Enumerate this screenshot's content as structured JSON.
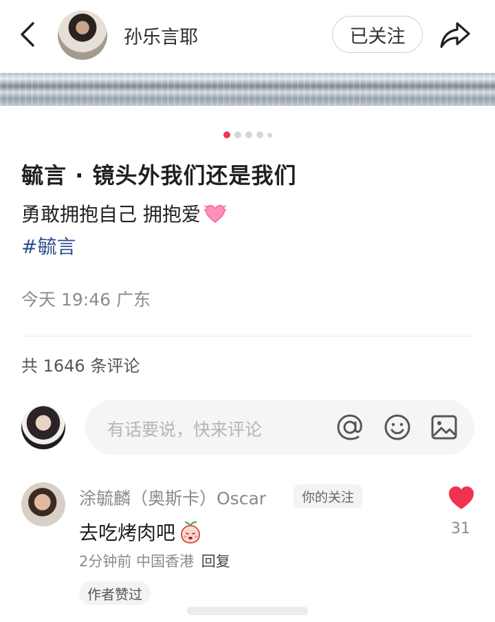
{
  "header": {
    "author_name": "孙乐言耶",
    "follow_label": "已关注",
    "icons": [
      "back-arrow-icon",
      "share-arrow-icon"
    ]
  },
  "carousel": {
    "total_dots": 5,
    "active_index": 0
  },
  "post": {
    "title": "毓言 · 镜头外我们还是我们",
    "body": "勇敢拥抱自己 拥抱爱",
    "body_emoji": "pink-heart-emoji",
    "hashtag": "#毓言",
    "meta": "今天 19:46 广东"
  },
  "comments_section": {
    "count_text": "共 1646 条评论",
    "input_placeholder": "有话要说，快来评论",
    "input_icons": [
      "at-icon",
      "smile-icon",
      "image-icon"
    ]
  },
  "comment": {
    "author": "涂毓麟（奥斯卡）Oscar",
    "tag": "你的关注",
    "text": "去吃烤肉吧",
    "text_emoji": "peach-emoji",
    "time": "2分钟前",
    "location": "中国香港",
    "reply_label": "回复",
    "author_liked_label": "作者赞过",
    "likes": "31"
  },
  "colors": {
    "accent": "#e8375a",
    "hashtag": "#2f4f8f",
    "muted_text": "#8b8b8b"
  }
}
